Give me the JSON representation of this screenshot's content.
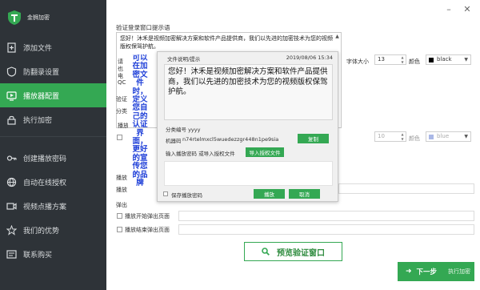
{
  "app": {
    "brand_name": "金狮加密"
  },
  "colors": {
    "sidebar_bg": "#2e3338",
    "accent_green": "#34a853",
    "highlight_blue": "#1e3fd8"
  },
  "sidebar": {
    "items": [
      {
        "label": "添加文件",
        "icon": "add-file-icon"
      },
      {
        "label": "防翻录设置",
        "icon": "shield-icon"
      },
      {
        "label": "播放器配置",
        "icon": "player-config-icon",
        "active": true
      },
      {
        "label": "执行加密",
        "icon": "lock-icon"
      },
      {
        "label": "创建播放密码",
        "icon": "key-icon"
      },
      {
        "label": "自动在线授权",
        "icon": "online-icon"
      },
      {
        "label": "视频点播方案",
        "icon": "video-icon"
      },
      {
        "label": "我们的优势",
        "icon": "star-icon"
      },
      {
        "label": "联系购买",
        "icon": "contact-icon"
      }
    ]
  },
  "window": {
    "minimize": "–",
    "close": "✕"
  },
  "main": {
    "section_prompt_title": "验证登录窗口提示语",
    "prompt_text": "您好！沐禾是视频加密解决方案和软件产品提供商，我们以先进的加密技术为您的视频版权保驾护航。",
    "hidden_labels": {
      "l1": "请",
      "l2": "也",
      "l3": "电",
      "l4": "QC",
      "s2": "验证",
      "fen": "分类",
      "bo": "播放",
      "bo2": "播放",
      "bo3": "播放",
      "tan": "弹出"
    },
    "font_size_label": "字体大小",
    "font_size_value": "13",
    "color_label": "颜色",
    "color_value": "black",
    "font_size_value_2": "10",
    "color_label_2": "颜色",
    "color_value_2": "blue",
    "checkbox_popup_label": "播放开始弹出页面",
    "checkbox_end_label": "播放结束弹出页面",
    "preview_button": "预览验证窗口",
    "next_button": "下一步",
    "next_sub": "执行加密"
  },
  "overlay_text": "可以在加密文件时，定义您自己的认证界面，更好的宣传您的品牌",
  "dialog": {
    "title": "文件说明/提示",
    "timestamp": "2019/08/06 15:34",
    "message": "您好！沐禾是视频加密解决方案和软件产品提供商，我们以先进的加密技术为您的视频版权保驾护航。",
    "category_label": "分类编号 yyyy",
    "machine_label": "机器码",
    "machine_code": "n74rtelmxcl5wuedezzgr448n1pe9sia",
    "copy_button": "复制",
    "input_label": "输入播放密码 或导入授权文件",
    "import_button": "导入授权文件",
    "save_password_label": "保存播放密码",
    "play_button": "播放",
    "cancel_button": "取消"
  }
}
